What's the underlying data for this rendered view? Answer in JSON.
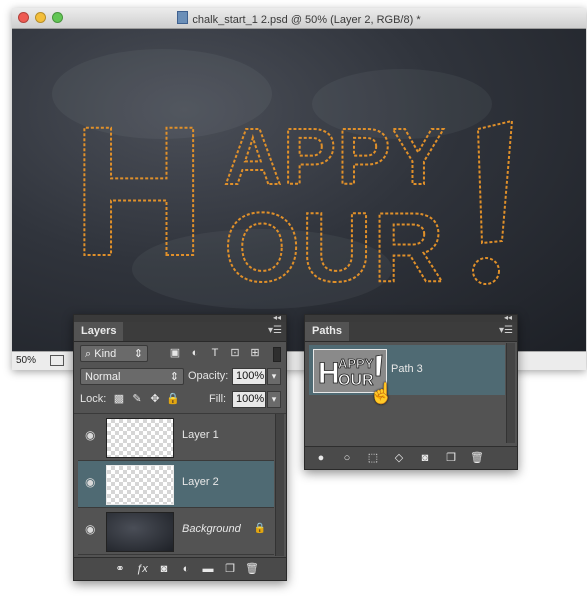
{
  "document": {
    "title": "chalk_start_1 2.psd @ 50% (Layer 2, RGB/8) *",
    "zoom": "50%",
    "artwork_text_line1": "HAPPY",
    "artwork_text_line2": "HOUR!"
  },
  "layers_panel": {
    "tab": "Layers",
    "filter_kind": "Kind",
    "blend_mode": "Normal",
    "opacity_label": "Opacity:",
    "opacity_value": "100%",
    "lock_label": "Lock:",
    "fill_label": "Fill:",
    "fill_value": "100%",
    "layers": [
      {
        "name": "Layer 1",
        "selected": false
      },
      {
        "name": "Layer 2",
        "selected": true
      },
      {
        "name": "Background",
        "selected": false,
        "locked": true
      }
    ]
  },
  "paths_panel": {
    "tab": "Paths",
    "paths": [
      {
        "name": "Path 3",
        "selected": true
      }
    ]
  },
  "colors": {
    "panel_bg": "#535353",
    "selected_row": "#4f6a73",
    "chalk_outline": "#e0902a",
    "chalkboard": "#30343c"
  }
}
